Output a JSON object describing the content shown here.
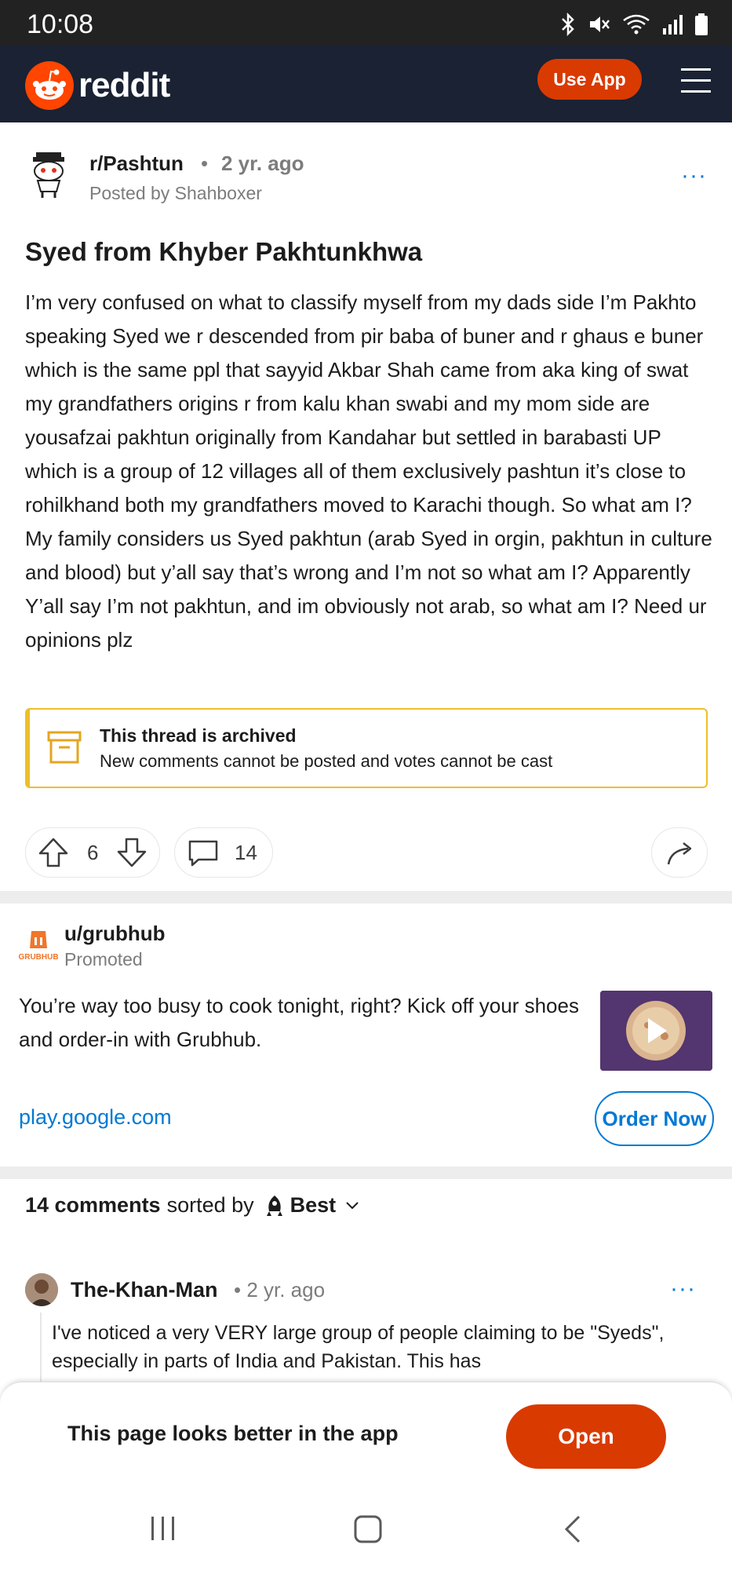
{
  "status_bar": {
    "time": "10:08"
  },
  "header": {
    "logo_text": "reddit",
    "use_app_label": "Use App"
  },
  "post": {
    "subreddit": "r/Pashtun",
    "time": "2 yr. ago",
    "posted_by": "Posted by Shahboxer",
    "title": "Syed from Khyber Pakhtunkhwa",
    "body": "I’m very confused on what to classify myself from my dads side I’m Pakhto speaking Syed we r descended from pir baba of buner and r ghaus e buner which is the same ppl that sayyid Akbar Shah came from aka king of swat my grandfathers origins r from kalu khan swabi and my mom side are yousafzai pakhtun originally from Kandahar but settled in barabasti UP which is a group of 12 villages all of them exclusively pashtun it’s close to rohilkhand both my grandfathers moved to Karachi though. So what am I? My family considers us Syed pakhtun (arab Syed in orgin, pakhtun in culture and blood) but y’all say that’s wrong and I’m not so what am I? Apparently Y’all say I’m not pakhtun, and im obviously not arab, so what am I? Need ur opinions plz",
    "archived_title": "This thread is archived",
    "archived_subtitle": "New comments cannot be posted and votes cannot be cast",
    "votes": "6",
    "comments": "14"
  },
  "ad": {
    "user": "u/grubhub",
    "logo_text": "GRUBHUB",
    "promoted": "Promoted",
    "text": "You’re way too busy to cook tonight, right? Kick off your shoes and order-in with Grubhub.",
    "link": "play.google.com",
    "cta": "Order Now"
  },
  "comments_header": {
    "count": "14 comments",
    "sorted_by": "sorted by",
    "sort": "Best"
  },
  "comment": {
    "author": "The-Khan-Man",
    "time": "2 yr. ago",
    "body": "I've noticed a very VERY large group of people claiming to be \"Syeds\", especially in parts of India and Pakistan. This has"
  },
  "bottom_sheet": {
    "text": "This page looks better in the app",
    "open_label": "Open"
  },
  "colors": {
    "brand": "#d93a00",
    "header_bg": "#1a2233",
    "link": "#0079d3",
    "archived_border": "#ecbf2b"
  }
}
